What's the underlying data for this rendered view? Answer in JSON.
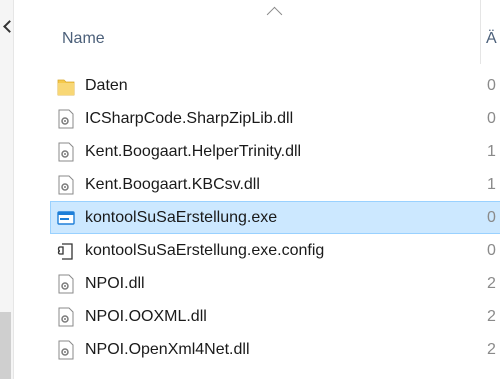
{
  "header": {
    "name_label": "Name",
    "next_col_label": "Ä"
  },
  "files": [
    {
      "name": "Daten",
      "col": "0",
      "icon": "folder-icon",
      "selected": false
    },
    {
      "name": "ICSharpCode.SharpZipLib.dll",
      "col": "0",
      "icon": "dll-file-icon",
      "selected": false
    },
    {
      "name": "Kent.Boogaart.HelperTrinity.dll",
      "col": "1",
      "icon": "dll-file-icon",
      "selected": false
    },
    {
      "name": "Kent.Boogaart.KBCsv.dll",
      "col": "1",
      "icon": "dll-file-icon",
      "selected": false
    },
    {
      "name": "kontoolSuSaErstellung.exe",
      "col": "0",
      "icon": "exe-window-icon",
      "selected": true
    },
    {
      "name": "kontoolSuSaErstellung.exe.config",
      "col": "0",
      "icon": "config-file-icon",
      "selected": false
    },
    {
      "name": "NPOI.dll",
      "col": "2",
      "icon": "dll-file-icon",
      "selected": false
    },
    {
      "name": "NPOI.OOXML.dll",
      "col": "2",
      "icon": "dll-file-icon",
      "selected": false
    },
    {
      "name": "NPOI.OpenXml4Net.dll",
      "col": "2",
      "icon": "dll-file-icon",
      "selected": false
    }
  ],
  "colors": {
    "selection_bg": "#cce8ff",
    "selection_border": "#99d1ff",
    "folder": "#f5c94b",
    "header_text": "#4c607a"
  }
}
